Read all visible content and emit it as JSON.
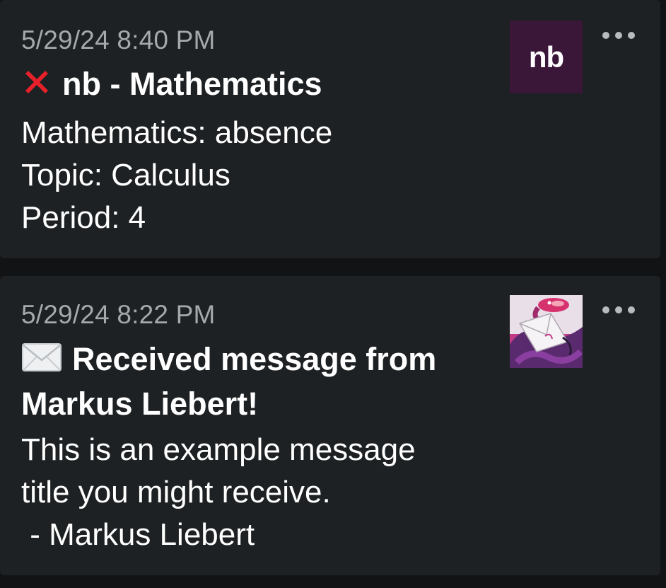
{
  "notifications": [
    {
      "timestamp": "5/29/24 8:40 PM",
      "title_icon": "cross-mark-icon",
      "title": "nb - Mathematics",
      "body_lines": [
        "Mathematics: absence",
        "Topic: Calculus",
        "Period: 4"
      ],
      "app_icon": "nb-logo",
      "app_icon_text": "nb",
      "app_icon_color": "#3a1638"
    },
    {
      "timestamp": "5/29/24 8:22 PM",
      "title_icon": "envelope-icon",
      "title_line1": "Received message from",
      "title_line2": "Markus Liebert!",
      "body_lines": [
        "This is an example message",
        "title you might receive.",
        " - Markus Liebert"
      ],
      "app_icon": "snake-envelope-avatar"
    }
  ],
  "colors": {
    "background": "#111315",
    "card": "#1d2123",
    "timestamp": "#a6a9ab",
    "text": "#ffffff",
    "cross": "#e8202a"
  }
}
